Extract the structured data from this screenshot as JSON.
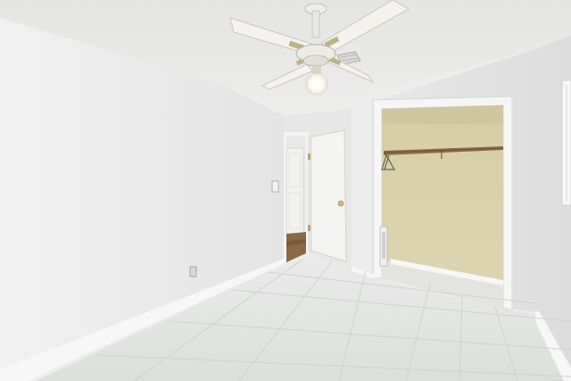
{
  "image": {
    "kind": "photo",
    "subject": "empty-bedroom-interior",
    "colors": {
      "ceiling": "#e9e9e7",
      "left_wall": "#eeeeee",
      "right_wall": "#e6e6e6",
      "floor_tile": "#e3e5e3",
      "closet_interior": "#d9d1ac",
      "door": "#f4f4f2",
      "hall_floor": "#8a6a45"
    }
  }
}
